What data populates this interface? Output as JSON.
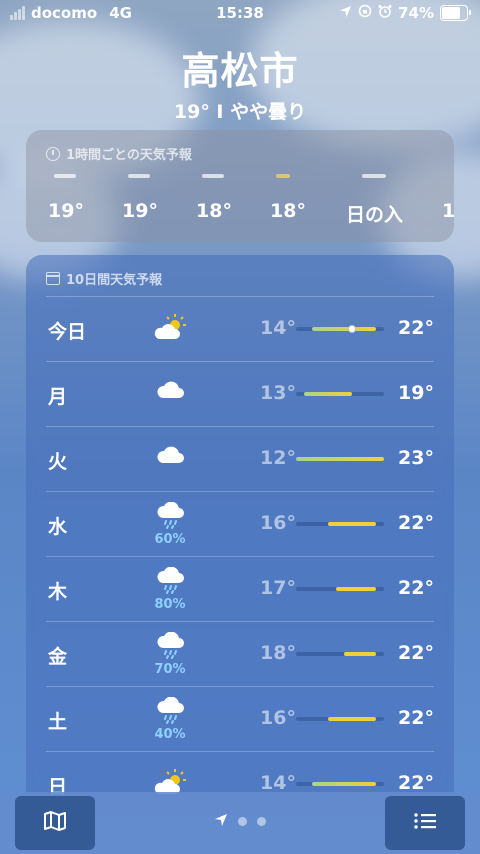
{
  "status_bar": {
    "carrier": "docomo",
    "network": "4G",
    "time": "15:38",
    "battery": "74%",
    "battery_level": 0.74
  },
  "header": {
    "city": "高松市",
    "current": "19°  I  やや曇り"
  },
  "hourly": {
    "title": "1時間ごとの天気予報",
    "items": [
      "19°",
      "19°",
      "18°",
      "18°",
      "日の入",
      "1"
    ]
  },
  "daily": {
    "title": "10日間天気予報",
    "range_min": 12,
    "range_max": 23,
    "current_temp": 19,
    "bar_colors": [
      "#a8d58a",
      "#f0cf3a"
    ],
    "rows": [
      {
        "day": "今日",
        "icon": "sun-behind-cloud-icon",
        "precip": "",
        "low": "14°",
        "high": "22°",
        "lo": 14,
        "hi": 22
      },
      {
        "day": "月",
        "icon": "cloud-icon",
        "precip": "",
        "low": "13°",
        "high": "19°",
        "lo": 13,
        "hi": 19
      },
      {
        "day": "火",
        "icon": "cloud-icon",
        "precip": "",
        "low": "12°",
        "high": "23°",
        "lo": 12,
        "hi": 23
      },
      {
        "day": "水",
        "icon": "cloud-rain-icon",
        "precip": "60%",
        "low": "16°",
        "high": "22°",
        "lo": 16,
        "hi": 22
      },
      {
        "day": "木",
        "icon": "cloud-rain-icon",
        "precip": "80%",
        "low": "17°",
        "high": "22°",
        "lo": 17,
        "hi": 22
      },
      {
        "day": "金",
        "icon": "cloud-rain-icon",
        "precip": "70%",
        "low": "18°",
        "high": "22°",
        "lo": 18,
        "hi": 22
      },
      {
        "day": "土",
        "icon": "cloud-rain-icon",
        "precip": "40%",
        "low": "16°",
        "high": "22°",
        "lo": 16,
        "hi": 22
      },
      {
        "day": "日",
        "icon": "sun-behind-cloud-icon",
        "precip": "",
        "low": "14°",
        "high": "22°",
        "lo": 14,
        "hi": 22
      }
    ]
  },
  "bottom_bar": {
    "left_icon": "map-icon",
    "right_icon": "list-icon",
    "page_count": 2
  }
}
